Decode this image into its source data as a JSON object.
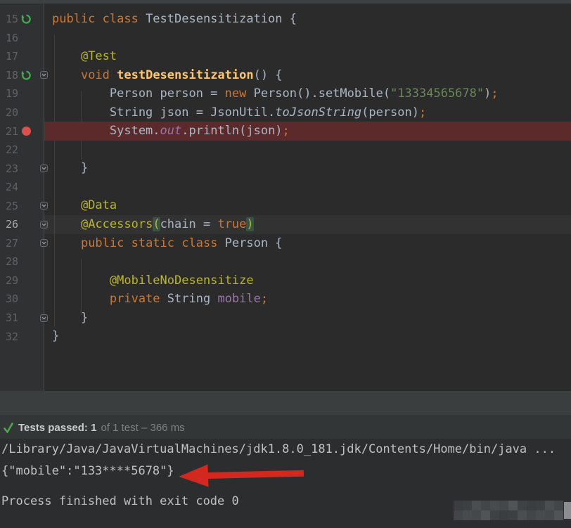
{
  "editor": {
    "lines": [
      {
        "no": "15",
        "icon": "run",
        "fold": false,
        "bp": false,
        "caret": false,
        "tokens": [
          [
            "public class ",
            "kw"
          ],
          [
            "TestDesensitization {",
            "id"
          ]
        ]
      },
      {
        "no": "16",
        "icon": "",
        "fold": false,
        "bp": false,
        "caret": false,
        "tokens": []
      },
      {
        "no": "17",
        "icon": "",
        "fold": false,
        "bp": false,
        "caret": false,
        "tokens": [
          [
            "    ",
            "id"
          ],
          [
            "@Test",
            "ann"
          ]
        ]
      },
      {
        "no": "18",
        "icon": "run",
        "fold": true,
        "bp": false,
        "caret": false,
        "tokens": [
          [
            "    ",
            "id"
          ],
          [
            "void ",
            "kw"
          ],
          [
            "testDesensitization",
            "mdecl"
          ],
          [
            "() {",
            "id"
          ]
        ]
      },
      {
        "no": "19",
        "icon": "",
        "fold": false,
        "bp": false,
        "caret": false,
        "tokens": [
          [
            "        Person person = ",
            "id"
          ],
          [
            "new ",
            "kw"
          ],
          [
            "Person().setMobile(",
            "id"
          ],
          [
            "\"13334565678\"",
            "str"
          ],
          [
            ")",
            "id"
          ],
          [
            ";",
            "semi"
          ]
        ]
      },
      {
        "no": "20",
        "icon": "",
        "fold": false,
        "bp": false,
        "caret": false,
        "tokens": [
          [
            "        String json = JsonUtil.",
            "id"
          ],
          [
            "toJsonString",
            "itl"
          ],
          [
            "(person)",
            "id"
          ],
          [
            ";",
            "semi"
          ]
        ]
      },
      {
        "no": "21",
        "icon": "breakpoint",
        "fold": false,
        "bp": true,
        "caret": false,
        "tokens": [
          [
            "        System.",
            "id"
          ],
          [
            "out",
            "fldi"
          ],
          [
            ".println(json)",
            "id"
          ],
          [
            ";",
            "semi"
          ]
        ]
      },
      {
        "no": "22",
        "icon": "",
        "fold": false,
        "bp": false,
        "caret": false,
        "tokens": []
      },
      {
        "no": "23",
        "icon": "",
        "fold": true,
        "bp": false,
        "caret": false,
        "tokens": [
          [
            "    }",
            "id"
          ]
        ]
      },
      {
        "no": "24",
        "icon": "",
        "fold": false,
        "bp": false,
        "caret": false,
        "tokens": []
      },
      {
        "no": "25",
        "icon": "",
        "fold": true,
        "bp": false,
        "caret": false,
        "tokens": [
          [
            "    ",
            "id"
          ],
          [
            "@Data",
            "ann"
          ]
        ]
      },
      {
        "no": "26",
        "icon": "",
        "fold": true,
        "bp": false,
        "caret": true,
        "tokens": [
          [
            "    ",
            "id"
          ],
          [
            "@Accessors",
            "ann"
          ],
          [
            "(",
            "phl"
          ],
          [
            "chain = ",
            "id"
          ],
          [
            "true",
            "kw"
          ],
          [
            ")",
            "phl"
          ]
        ]
      },
      {
        "no": "27",
        "icon": "",
        "fold": true,
        "bp": false,
        "caret": false,
        "tokens": [
          [
            "    ",
            "id"
          ],
          [
            "public static class ",
            "kw"
          ],
          [
            "Person {",
            "id"
          ]
        ]
      },
      {
        "no": "28",
        "icon": "",
        "fold": false,
        "bp": false,
        "caret": false,
        "tokens": []
      },
      {
        "no": "29",
        "icon": "",
        "fold": false,
        "bp": false,
        "caret": false,
        "tokens": [
          [
            "        ",
            "id"
          ],
          [
            "@MobileNoDesensitize",
            "ann"
          ]
        ]
      },
      {
        "no": "30",
        "icon": "",
        "fold": false,
        "bp": false,
        "caret": false,
        "tokens": [
          [
            "        ",
            "id"
          ],
          [
            "private ",
            "kw"
          ],
          [
            "String ",
            "id"
          ],
          [
            "mobile",
            "fld"
          ],
          [
            ";",
            "semi"
          ]
        ]
      },
      {
        "no": "31",
        "icon": "",
        "fold": true,
        "bp": false,
        "caret": false,
        "tokens": [
          [
            "    }",
            "id"
          ]
        ]
      },
      {
        "no": "32",
        "icon": "",
        "fold": false,
        "bp": false,
        "caret": false,
        "tokens": [
          [
            "}",
            "id"
          ]
        ]
      }
    ]
  },
  "test_bar": {
    "status_icon": "check-icon",
    "passed_label": "Tests passed: 1",
    "detail_label": "of 1 test – 366 ms"
  },
  "console": {
    "lines": [
      "/Library/Java/JavaVirtualMachines/jdk1.8.0_181.jdk/Contents/Home/bin/java ...",
      "{\"mobile\":\"133****5678\"}",
      "",
      "Process finished with exit code 0"
    ]
  },
  "annotation": {
    "arrow": "red-arrow-pointing-left-at-masked-json-output"
  },
  "colors": {
    "editor_bg": "#2b2b2b",
    "gutter_bg": "#2f3133",
    "breakpoint_line_bg": "#5c2a2a",
    "breakpoint_dot": "#db5150",
    "run_icon_green": "#3fae49",
    "keyword_orange": "#cc7832",
    "annotation_yellow": "#bbb529",
    "string_green": "#6a8759",
    "method_yellow": "#ffc66d",
    "field_purple": "#9876aa",
    "default_text": "#a9b7c6",
    "line_number": "#606366",
    "panel_band": "#3b3e3f",
    "test_row_bg": "#323637",
    "check_green": "#4ca64f",
    "console_text": "#bfc1c3",
    "arrow_red": "#d2281e"
  }
}
